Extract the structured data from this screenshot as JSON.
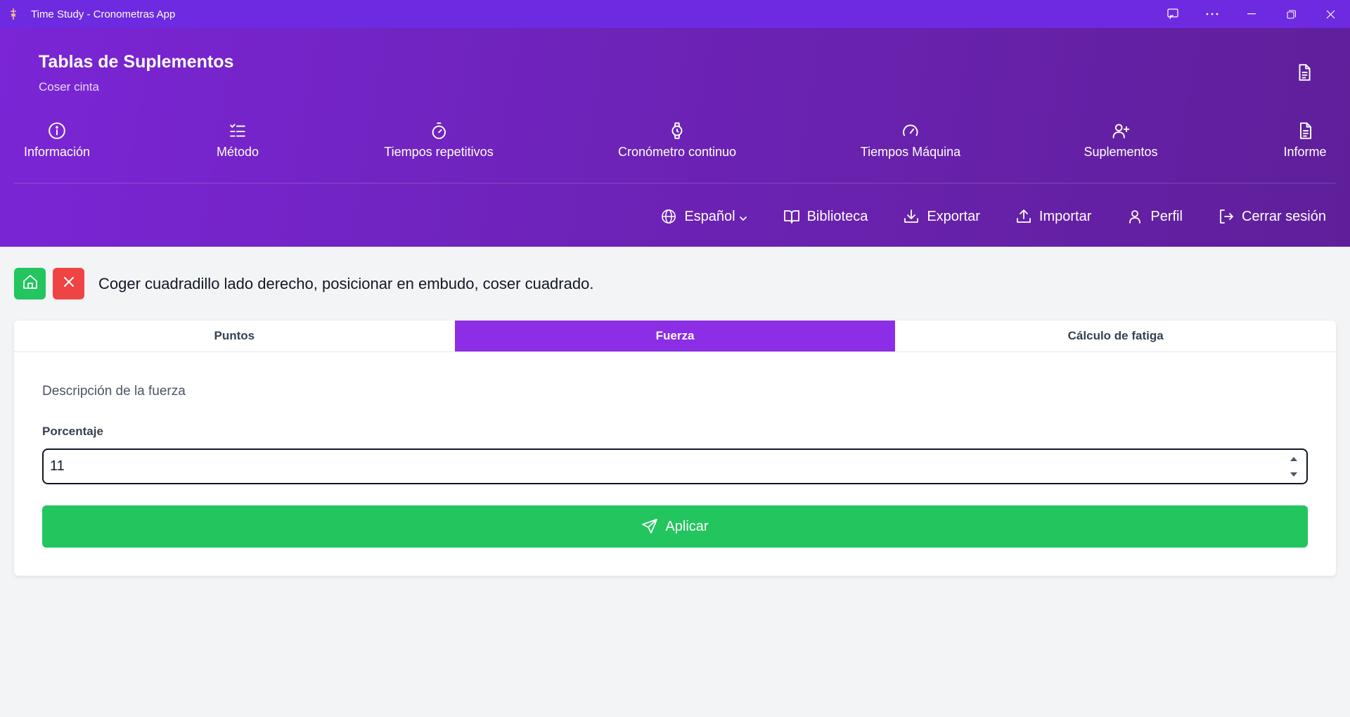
{
  "window": {
    "title": "Time Study - Cronometras App",
    "controls": [
      "cast-icon",
      "more-icon",
      "minimize-icon",
      "restore-icon",
      "close-icon"
    ]
  },
  "header": {
    "title": "Tablas de Suplementos",
    "subtitle": "Coser cinta",
    "report_icon": "document-icon"
  },
  "nav": [
    {
      "label": "Información",
      "icon": "info-icon"
    },
    {
      "label": "Método",
      "icon": "list-check-icon"
    },
    {
      "label": "Tiempos repetitivos",
      "icon": "stopwatch-icon"
    },
    {
      "label": "Cronómetro continuo",
      "icon": "watch-icon"
    },
    {
      "label": "Tiempos Máquina",
      "icon": "gauge-icon"
    },
    {
      "label": "Suplementos",
      "icon": "user-plus-icon"
    },
    {
      "label": "Informe",
      "icon": "document-icon"
    }
  ],
  "toolbar": {
    "language": "Español",
    "library": "Biblioteca",
    "export": "Exportar",
    "import": "Importar",
    "profile": "Perfil",
    "logout": "Cerrar sesión"
  },
  "task": {
    "description": "Coger cuadradillo lado derecho, posicionar en embudo, coser cuadrado."
  },
  "tabs": [
    {
      "label": "Puntos",
      "active": false
    },
    {
      "label": "Fuerza",
      "active": true
    },
    {
      "label": "Cálculo de fatiga",
      "active": false
    }
  ],
  "form": {
    "description_label": "Descripción de la fuerza",
    "percentage_label": "Porcentaje",
    "percentage_value": "11",
    "apply_label": "Aplicar"
  },
  "colors": {
    "titlebar": "#6d2ae0",
    "header_start": "#7b25d6",
    "header_end": "#5f1f9a",
    "active_tab": "#8b2ee6",
    "success": "#22c55e",
    "danger": "#ef4444"
  }
}
